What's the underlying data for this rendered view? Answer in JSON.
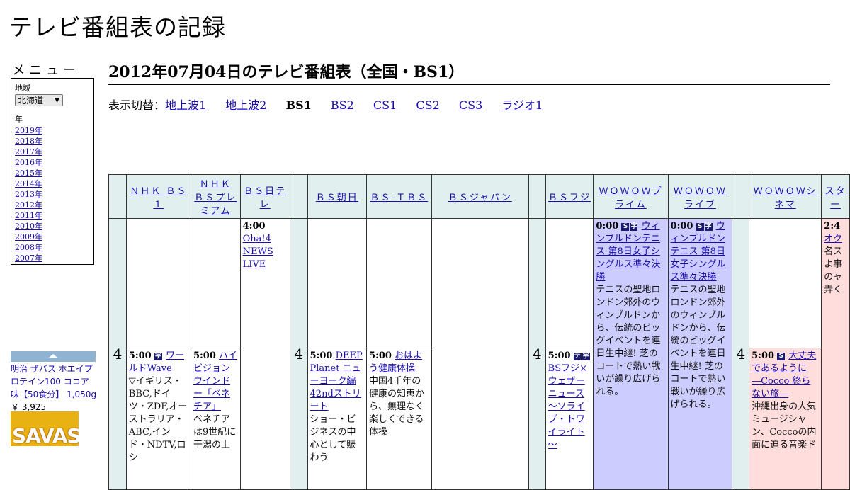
{
  "site_title": "テレビ番組表の記録",
  "menu": {
    "title": "メニュー",
    "region_label": "地域",
    "region_value": "北海道",
    "year_label": "年",
    "years": [
      "2019年",
      "2018年",
      "2017年",
      "2016年",
      "2015年",
      "2014年",
      "2013年",
      "2012年",
      "2011年",
      "2010年",
      "2009年",
      "2008年",
      "2007年"
    ]
  },
  "ad": {
    "text_line1": "明治 ザバス ホエイプロテイン100 ココア味【50食分】 1,050g",
    "price": "￥ 3,925",
    "image_text": "SAVAS"
  },
  "heading": "2012年07月04日のテレビ番組表（全国・BS1）",
  "switch": {
    "label": "表示切替：",
    "items": [
      {
        "text": "地上波1",
        "current": false
      },
      {
        "text": "地上波2",
        "current": false
      },
      {
        "text": "BS1",
        "current": true
      },
      {
        "text": "BS2",
        "current": false
      },
      {
        "text": "CS1",
        "current": false
      },
      {
        "text": "CS2",
        "current": false
      },
      {
        "text": "CS3",
        "current": false
      },
      {
        "text": "ラジオ1",
        "current": false
      }
    ]
  },
  "channels": {
    "c1": "ＮＨＫ ＢＳ１",
    "c2": "ＮＨＫ ＢＳプレミアム",
    "c3": "ＢＳ日テレ",
    "c4": "ＢＳ朝日",
    "c5": "ＢＳ-ＴＢＳ",
    "c6": "ＢＳジャパン",
    "c7": "ＢＳフジ",
    "c8": "ＷＯＷＯＷプライム",
    "c9": "ＷＯＷＯＷライブ",
    "c10": "ＷＯＷＯＷシネマ",
    "c11": "スター"
  },
  "hour": "4",
  "programs": {
    "nittele": {
      "time": "4:00",
      "title": "Oha!4 NEWS LIVE"
    },
    "wprime": {
      "time": "0:00",
      "badges": [
        "S",
        "字"
      ],
      "title": "ウィンブルドンテニス 第8日女子シングルス準々決勝",
      "desc": "テニスの聖地ロンドン郊外のウィンブルドンから、伝統のビッグイベントを連日生中継! 芝のコートで熱い戦いが繰り広げられる。"
    },
    "wlive": {
      "time": "0:00",
      "badges": [
        "S",
        "字"
      ],
      "title": "ウィンブルドンテニス 第8日女子シングルス準々決勝",
      "desc": "テニスの聖地ロンドン郊外のウィンブルドンから、伝統のビッグイベントを連日生中継! 芝のコートで熱い戦いが繰り広げられる。"
    },
    "star": {
      "time": "2:4",
      "title": "オク",
      "desc": "名スよ事のャ弄く"
    },
    "bs1": {
      "time": "5:00",
      "badges": [
        "字"
      ],
      "title": "ワールドWave",
      "desc": "▽イギリス・BBC,ドイツ・ZDF,オーストラリア・ABC,インド・NDTV,ロシ"
    },
    "premium": {
      "time": "5:00",
      "title": "ハイビジョンウインドー「ベネチア」",
      "desc": "ベネチアは9世紀に干潟の上"
    },
    "asahi": {
      "time": "5:00",
      "title": "DEEP Planet ニューヨーク編 42ndストリート",
      "desc": "ショー・ビジネスの中心として賑わう"
    },
    "tbs": {
      "time": "5:00",
      "title": "おはよう健康体操",
      "desc": "中国4千年の健康の知恵から、無理なく楽しくできる体操"
    },
    "fuji": {
      "time": "5:00",
      "badges": [
        "デ",
        "字"
      ],
      "title": "BSフジ×ウェザーニュース～ソライブ・トワイライト～"
    },
    "cinema": {
      "time": "5:00",
      "badges": [
        "S"
      ],
      "title": "大丈夫であるように ―Cocco 終らない旅―",
      "desc": "沖縄出身の人気ミュージシャン、Coccoの内面に迫る音楽ド"
    }
  }
}
